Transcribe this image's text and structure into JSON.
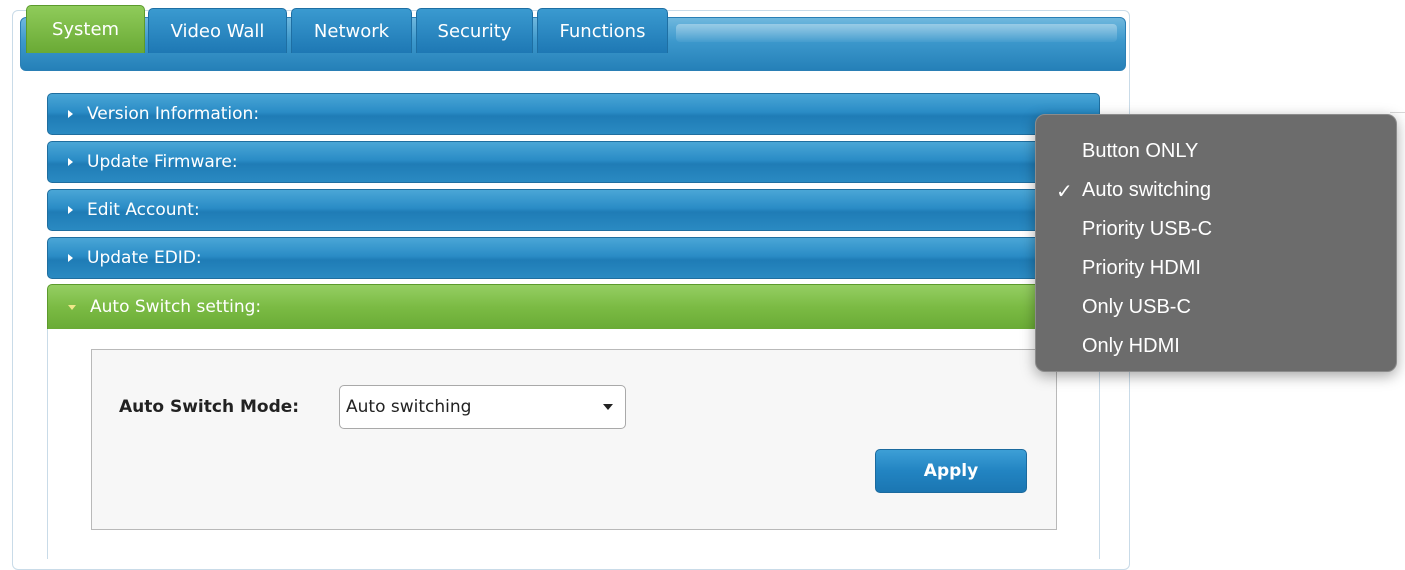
{
  "tabs": [
    {
      "label": "System",
      "active": true
    },
    {
      "label": "Video Wall",
      "active": false
    },
    {
      "label": "Network",
      "active": false
    },
    {
      "label": "Security",
      "active": false
    },
    {
      "label": "Functions",
      "active": false
    }
  ],
  "panels": [
    {
      "label": "Version Information:",
      "expanded": false
    },
    {
      "label": "Update Firmware:",
      "expanded": false
    },
    {
      "label": "Edit Account:",
      "expanded": false
    },
    {
      "label": "Update EDID:",
      "expanded": false
    },
    {
      "label": "Auto Switch setting:",
      "expanded": true
    }
  ],
  "auto_switch": {
    "mode_label": "Auto Switch Mode:",
    "selected_value": "Auto switching",
    "apply_label": "Apply"
  },
  "dropdown": {
    "options": [
      {
        "label": "Button ONLY",
        "checked": false
      },
      {
        "label": "Auto switching",
        "checked": true
      },
      {
        "label": "Priority USB-C",
        "checked": false
      },
      {
        "label": "Priority HDMI",
        "checked": false
      },
      {
        "label": "Only USB-C",
        "checked": false
      },
      {
        "label": "Only HDMI",
        "checked": false
      }
    ],
    "check_mark": "✓"
  },
  "colors": {
    "tab_blue": "#2a8cc6",
    "tab_active_green": "#7bbb44",
    "dropdown_bg": "#6c6c6c"
  }
}
